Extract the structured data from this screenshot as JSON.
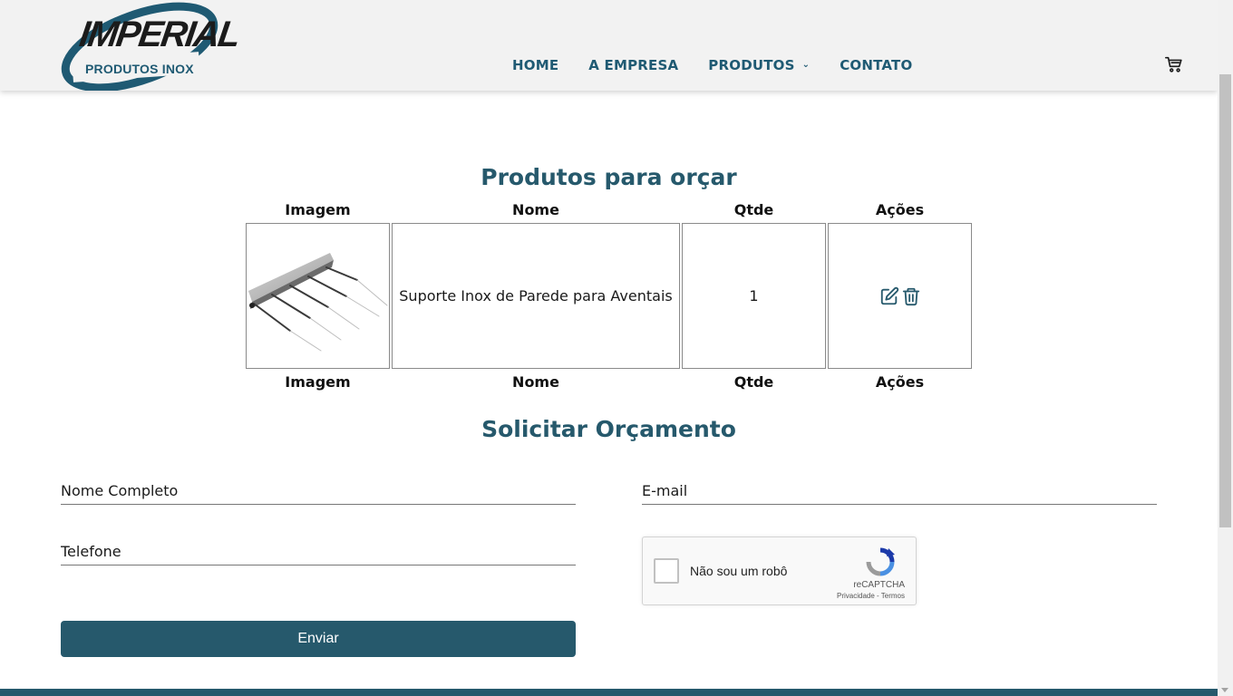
{
  "logo": {
    "word": "IMPERIAL",
    "sub": "PRODUTOS INOX"
  },
  "nav": {
    "items": [
      {
        "label": "HOME"
      },
      {
        "label": "A EMPRESA"
      },
      {
        "label": "PRODUTOS",
        "has_dropdown": true
      },
      {
        "label": "CONTATO"
      }
    ],
    "cart_icon": "cart-icon"
  },
  "cart_section": {
    "title": "Produtos para orçar",
    "columns": [
      "Imagem",
      "Nome",
      "Qtde",
      "Ações"
    ],
    "rows": [
      {
        "image_icon": "product-rack-image",
        "name": "Suporte Inox de Parede para Aventais",
        "qty": "1",
        "actions": [
          "edit-icon",
          "trash-icon"
        ]
      }
    ]
  },
  "form": {
    "title": "Solicitar Orçamento",
    "name_placeholder": "Nome Completo",
    "email_placeholder": "E-mail",
    "phone_placeholder": "Telefone",
    "submit_label": "Enviar"
  },
  "recaptcha": {
    "label": "Não sou um robô",
    "brand": "reCAPTCHA",
    "links": "Privacidade - Termos"
  },
  "colors": {
    "primary": "#26596c",
    "nav_text": "#1f5a73",
    "header_bg": "#f2f2f2"
  }
}
